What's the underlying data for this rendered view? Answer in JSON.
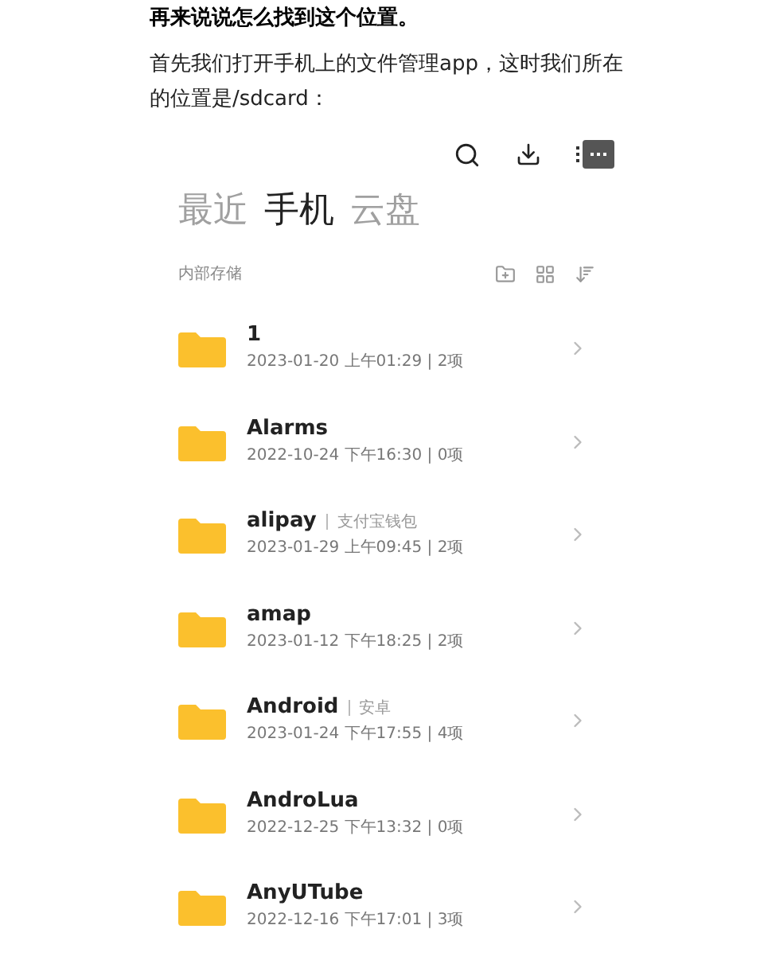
{
  "heading": "再来说说怎么找到这个位置。",
  "paragraph": "首先我们打开手机上的文件管理app，这时我们所在的位置是/sdcard：",
  "tabs": [
    {
      "label": "最近",
      "selected": false
    },
    {
      "label": "手机",
      "selected": true
    },
    {
      "label": "云盘",
      "selected": false
    }
  ],
  "location": "内部存储",
  "folders": [
    {
      "name": "1",
      "meta": "2023-01-20 上午01:29 | 2项"
    },
    {
      "name": "Alarms",
      "meta": "2022-10-24 下午16:30 | 0项"
    },
    {
      "name": "alipay",
      "tag": "支付宝钱包",
      "meta": "2023-01-29 上午09:45 | 2项"
    },
    {
      "name": "amap",
      "meta": "2023-01-12 下午18:25 | 2项"
    },
    {
      "name": "Android",
      "tag": "安卓",
      "meta": "2023-01-24 下午17:55 | 4项"
    },
    {
      "name": "AndroLua",
      "meta": "2022-12-25 下午13:32 | 0项"
    },
    {
      "name": "AnyUTube",
      "meta": "2022-12-16 下午17:01 | 3项"
    }
  ]
}
